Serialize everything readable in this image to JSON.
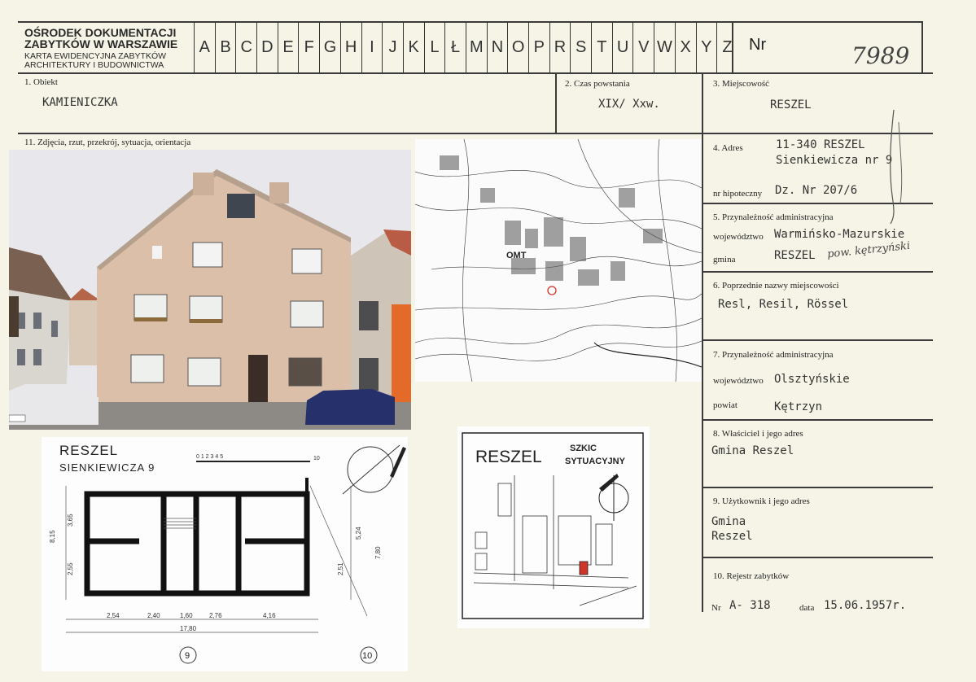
{
  "header": {
    "institution_line1": "OŚRODEK DOKUMENTACJI",
    "institution_line2": "ZABYTKÓW W WARSZAWIE",
    "institution_line3": "KARTA EWIDENCYJNA ZABYTKÓW",
    "institution_line4": "ARCHITEKTURY I BUDOWNICTWA",
    "letters": [
      "A",
      "B",
      "C",
      "D",
      "E",
      "F",
      "G",
      "H",
      "I",
      "J",
      "K",
      "L",
      "Ł",
      "M",
      "N",
      "O",
      "P",
      "R",
      "S",
      "T",
      "U",
      "V",
      "W",
      "X",
      "Y",
      "Z"
    ],
    "nr_label": "Nr",
    "nr_value": "7989"
  },
  "fields": {
    "f1_label": "1. Obiekt",
    "f1_value": "KAMIENICZKA",
    "f2_label": "2. Czas powstania",
    "f2_value": "XIX/ Xxw.",
    "f3_label": "3. Miejscowość",
    "f3_value": "RESZEL",
    "f11_label": "11. Zdjęcia, rzut, przekrój, sytuacja, orientacja",
    "f4_label": "4. Adres",
    "f4_value_line1": "11-340 RESZEL",
    "f4_value_line2": "Sienkiewicza nr 9",
    "hipoteczny_label": "nr hipoteczny",
    "hipoteczny_value": "Dz. Nr 207/6",
    "f5_label": "5. Przynależność administracyjna",
    "woj_label": "województwo",
    "f5_woj_value": "Warmińsko-Mazurskie",
    "gmina_label": "gmina",
    "f5_gmina_value": "RESZEL",
    "f5_gmina_hand": "pow. kętrzyński",
    "f6_label": "6. Poprzednie nazwy miejscowości",
    "f6_value": "Resl, Resil, Rössel",
    "f7_label": "7. Przynależność administracyjna",
    "f7_woj_value": "Olsztyńskie",
    "powiat_label": "powiat",
    "f7_powiat_value": "Kętrzyn",
    "f8_label": "8. Właściciel i jego adres",
    "f8_value": "Gmina Reszel",
    "f9_label": "9. Użytkownik i jego adres",
    "f9_value_line1": "Gmina",
    "f9_value_line2": "Reszel",
    "f10_label": "10. Rejestr zabytków",
    "f10_nr_label": "Nr",
    "f10_nr_value": "A- 318",
    "f10_data_label": "data",
    "f10_data_value": "15.06.1957r."
  },
  "plan": {
    "title_line1": "RESZEL",
    "title_line2": "SIENKIEWICZA 9",
    "scale_text": "0 1 2 3 4 5",
    "scale_end": "10",
    "dims_bottom": [
      "2,54",
      "2,40",
      "1,60",
      "2,76",
      "4,16"
    ],
    "total": "17,80",
    "dim_left": [
      "8,15",
      "2,55",
      "3,65"
    ],
    "dim_right": [
      "5,24",
      "7,80",
      "2,51"
    ],
    "axis_a": "9",
    "axis_b": "10"
  },
  "sketch": {
    "title": "RESZEL",
    "subtitle_line1": "SZKIC",
    "subtitle_line2": "SYTUACYJNY"
  },
  "map": {
    "label_omt": "OMT"
  },
  "colors": {
    "card": "#f6f4e6",
    "facade": "#dcbfa8",
    "sky": "#e7e7ea",
    "accent_red": "#d0352a"
  }
}
